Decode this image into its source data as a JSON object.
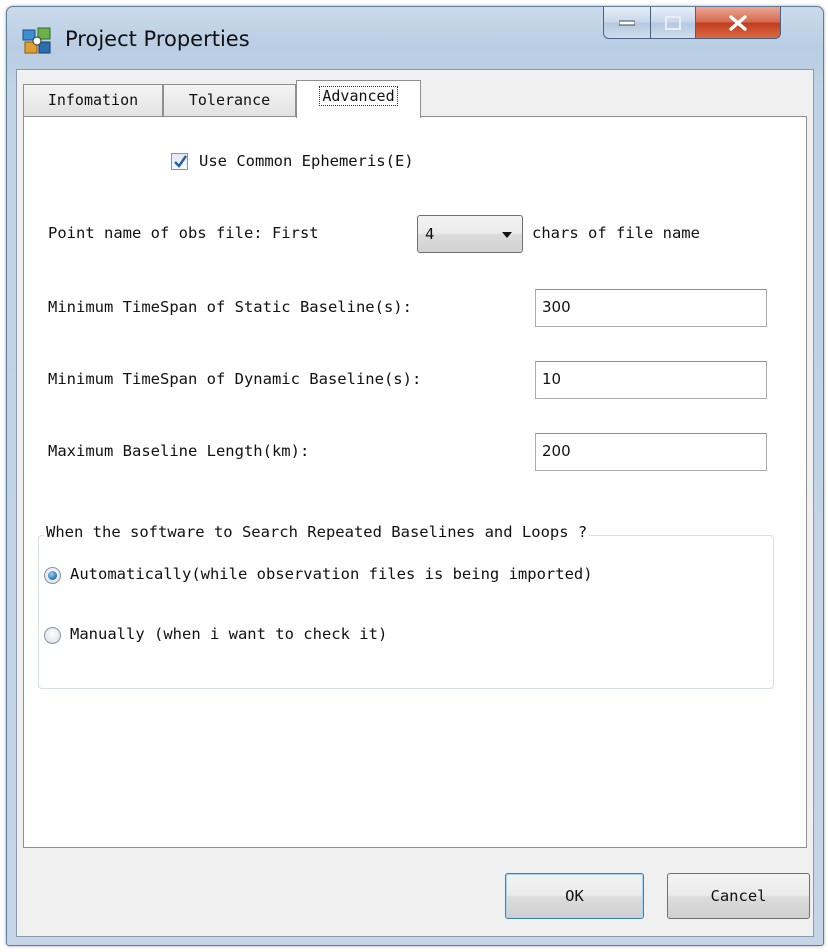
{
  "window": {
    "title": "Project Properties",
    "icon": "app-icon",
    "controls": {
      "minimize": "minimize-icon",
      "maximize": "maximize-icon",
      "close": "close-icon"
    }
  },
  "tabs": [
    {
      "label": "Infomation",
      "active": false
    },
    {
      "label": "Tolerance",
      "active": false
    },
    {
      "label": "Advanced",
      "active": true
    }
  ],
  "advanced": {
    "use_common_ephemeris": {
      "label": "Use Common Ephemeris(E)",
      "checked": true
    },
    "point_name": {
      "prefix": "Point name of obs file: First",
      "value": "4",
      "suffix": "chars of file name"
    },
    "min_static": {
      "label": "Minimum TimeSpan of Static Baseline(s):",
      "value": "300"
    },
    "min_dynamic": {
      "label": "Minimum TimeSpan of Dynamic Baseline(s):",
      "value": "10"
    },
    "max_length": {
      "label": "Maximum Baseline Length(km):",
      "value": "200"
    },
    "search_group": {
      "title": "When the software to Search Repeated Baselines and Loops ?",
      "options": [
        {
          "label": "Automatically(while observation files is being imported)",
          "selected": true
        },
        {
          "label": "Manually (when i want to check it)",
          "selected": false
        }
      ]
    }
  },
  "buttons": {
    "ok": "OK",
    "cancel": "Cancel"
  },
  "colors": {
    "accent": "#1f6fb5",
    "close_button": "#c23d1d",
    "title_bar": "#b9cde3"
  }
}
